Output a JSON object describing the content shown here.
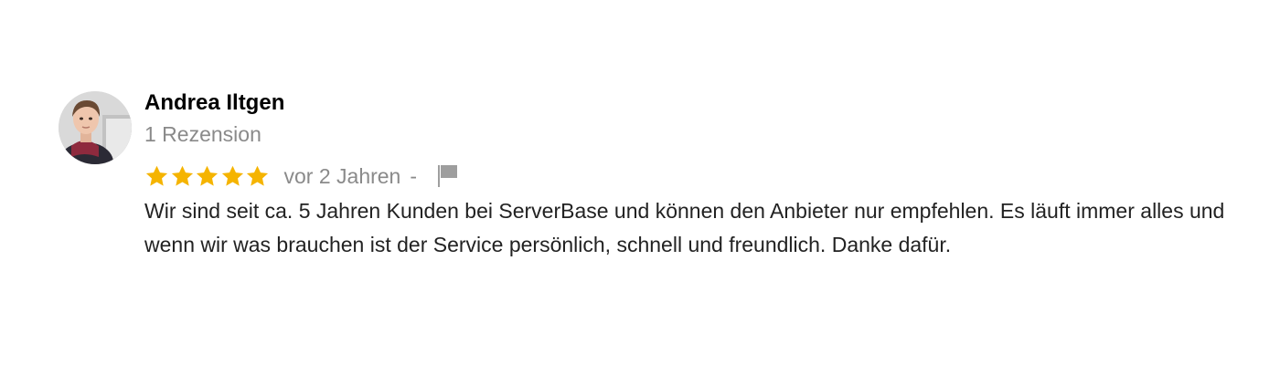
{
  "review": {
    "author_name": "Andrea Iltgen",
    "review_count": "1 Rezension",
    "rating": 5,
    "rating_max": 5,
    "star_color": "#f5b400",
    "time_ago": "vor 2 Jahren",
    "separator": "-",
    "flag_icon": "flag-icon",
    "text": "Wir sind seit ca. 5 Jahren Kunden bei ServerBase und können den Anbieter nur empfehlen. Es läuft immer alles und wenn wir was brauchen ist der Service persönlich, schnell und freundlich. Danke dafür."
  }
}
